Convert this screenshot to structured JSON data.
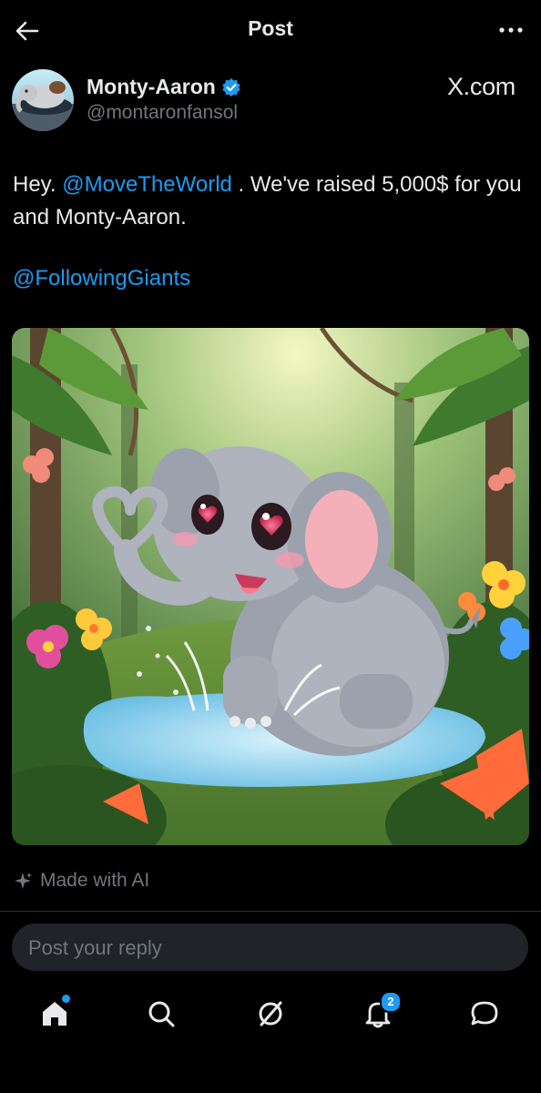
{
  "header": {
    "title": "Post",
    "back_icon": "arrow-left-icon",
    "more_icon": "more-horizontal-icon"
  },
  "author": {
    "name": "Monty-Aaron",
    "handle": "@montaronfansol",
    "verified": true,
    "verified_color": "#1d9bf0",
    "avatar": "elephant-avatar"
  },
  "source": "X.com",
  "post": {
    "text_prefix": "Hey. ",
    "mention1": "@MoveTheWorld",
    "text_suffix": " . We've raised 5,000$ for you and Monty-Aaron.",
    "mention2": "@FollowingGiants",
    "mention_color": "#1d9bf0",
    "image": "cartoon-elephant-jungle-image"
  },
  "ai_label": "Made with AI",
  "reply": {
    "placeholder": "Post your reply"
  },
  "tabbar": {
    "items": [
      {
        "name": "home",
        "icon": "home-icon",
        "active": true,
        "dot": true
      },
      {
        "name": "search",
        "icon": "search-icon"
      },
      {
        "name": "grok",
        "icon": "grok-icon"
      },
      {
        "name": "notifications",
        "icon": "bell-icon",
        "badge": "2"
      },
      {
        "name": "messages",
        "icon": "message-icon"
      }
    ]
  },
  "colors": {
    "background": "#000000",
    "text": "#e7e9ea",
    "muted": "#71767b",
    "accent": "#1d9bf0"
  }
}
